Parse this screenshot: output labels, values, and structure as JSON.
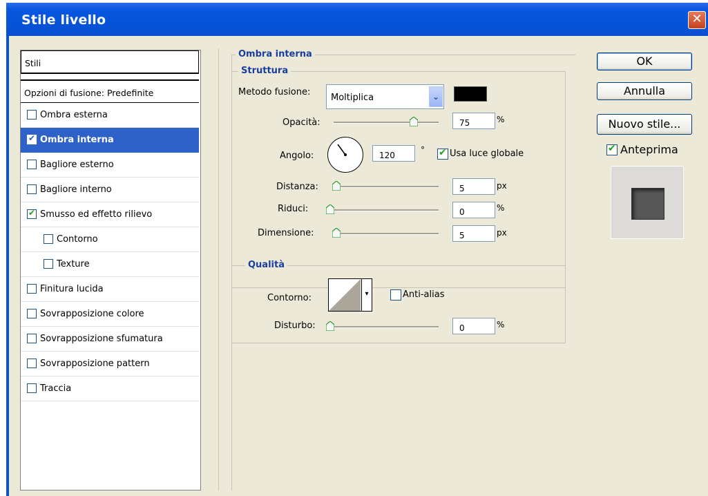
{
  "window": {
    "title": "Stile livello",
    "close_glyph": "✕"
  },
  "styles_panel": {
    "header": "Stili",
    "blend_options": "Opzioni di fusione: Predefinite",
    "items": [
      {
        "label": "Ombra esterna",
        "checked": false
      },
      {
        "label": "Ombra interna",
        "checked": true,
        "selected": true
      },
      {
        "label": "Bagliore esterno",
        "checked": false
      },
      {
        "label": "Bagliore interno",
        "checked": false
      },
      {
        "label": "Smusso ed effetto rilievo",
        "checked": true
      },
      {
        "label": "Contorno",
        "checked": false,
        "indent": true
      },
      {
        "label": "Texture",
        "checked": false,
        "indent": true
      },
      {
        "label": "Finitura lucida",
        "checked": false
      },
      {
        "label": "Sovrapposizione colore",
        "checked": false
      },
      {
        "label": "Sovrapposizione sfumatura",
        "checked": false
      },
      {
        "label": "Sovrapposizione pattern",
        "checked": false
      },
      {
        "label": "Traccia",
        "checked": false
      }
    ]
  },
  "inner_shadow": {
    "title": "Ombra interna",
    "structure": {
      "title": "Struttura",
      "blend_mode_label": "Metodo fusione:",
      "blend_mode_value": "Moltiplica",
      "shadow_color": "#000000",
      "opacity_label": "Opacità:",
      "opacity_value": "75",
      "opacity_unit": "%",
      "angle_label": "Angolo:",
      "angle_value": "120",
      "angle_unit": "°",
      "global_light_label": "Usa luce globale",
      "global_light_checked": true,
      "distance_label": "Distanza:",
      "distance_value": "5",
      "distance_unit": "px",
      "choke_label": "Riduci:",
      "choke_value": "0",
      "choke_unit": "%",
      "size_label": "Dimensione:",
      "size_value": "5",
      "size_unit": "px"
    },
    "quality": {
      "title": "Qualità",
      "contour_label": "Contorno:",
      "antialias_label": "Anti-alias",
      "antialias_checked": false,
      "noise_label": "Disturbo:",
      "noise_value": "0",
      "noise_unit": "%"
    }
  },
  "buttons": {
    "ok": "OK",
    "cancel": "Annulla",
    "new_style": "Nuovo stile...",
    "preview_label": "Anteprima",
    "preview_checked": true
  },
  "icons": {
    "dropdown": "chevron-down-icon",
    "close": "close-icon",
    "checkmark": "checkmark-icon",
    "slider_thumb": "slider-thumb-icon"
  }
}
